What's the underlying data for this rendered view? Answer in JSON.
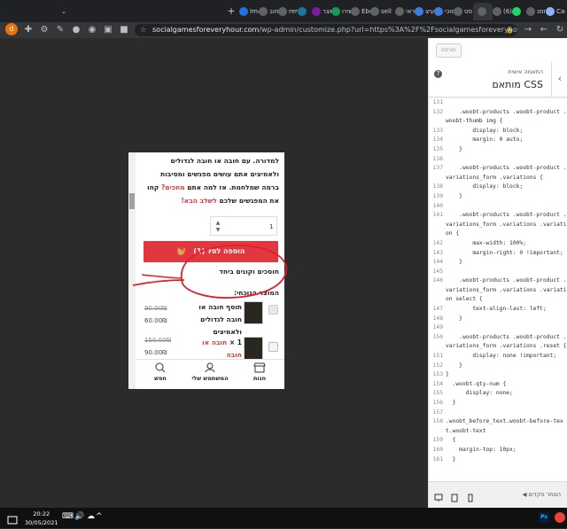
{
  "browser": {
    "tabs": [
      {
        "label": "Car",
        "icon_color": "#8ab4f8",
        "active": false
      },
      {
        "label": "הזמנ",
        "icon_color": "#5f6368",
        "active": false
      },
      {
        "label": "",
        "icon_color": "#25d366",
        "active": false
      },
      {
        "label": "(6)",
        "icon_color": "#5f6368",
        "active": false
      },
      {
        "label": "",
        "icon_color": "#5f6368",
        "active": true
      },
      {
        "label": "סט",
        "icon_color": "#5f6368",
        "active": false
      },
      {
        "label": "פוכי",
        "icon_color": "#3b7ddd",
        "active": false
      },
      {
        "label": "עיצ",
        "icon_color": "#3b7ddd",
        "active": false
      },
      {
        "label": "הוראי",
        "icon_color": "#5f6368",
        "active": false
      },
      {
        "label": "sell",
        "icon_color": "#5f6368",
        "active": false
      },
      {
        "label": "Ebo",
        "icon_color": "#5f6368",
        "active": false
      },
      {
        "label": "שירו",
        "icon_color": "#0f9d58",
        "active": false
      },
      {
        "label": "מצר",
        "icon_color": "#7b1fa2",
        "active": false
      },
      {
        "label": "",
        "icon_color": "#21759b",
        "active": false
      },
      {
        "label": "rem",
        "icon_color": "#5f6368",
        "active": false
      },
      {
        "label": "חוב",
        "icon_color": "#5f6368",
        "active": false
      },
      {
        "label": "Ima",
        "icon_color": "#1a73e8",
        "active": false
      }
    ],
    "new_tab_label": "+",
    "url_domain": "socialgamesforeveryhour.com",
    "url_path": "/wp-admin/customize.php?url=https%3A%2F%2Fsocialgamesforeveryhour.com%2F..."
  },
  "preview": {
    "paragraph": "למדורה. עם חובה או חובה לגדולים ולאמיצים אתם עושים מפגשים ומסיבות ברמה שמלחמת. אז למה אתם",
    "paragraph_red": "מחכים?",
    "paragraph_tail": "קחו את המפגשים שלכם",
    "paragraph_link": "לשלב הבא!",
    "quantity": "1",
    "add_to_cart": "הוספה לסל (1)",
    "bought_together": "חוסכים וקונים ביחד",
    "current_product_label": "המוצר הנוכחי:",
    "items": [
      {
        "name": "תוסף חובה או חובה לגדולים ולאמיצים",
        "old_price": "90.00₪",
        "new_price": "60.00₪"
      },
      {
        "qty_prefix": "1 ×",
        "name_red": "חובה או חובה",
        "old_price": "150.00₪",
        "new_price": "90.00₪"
      }
    ],
    "bottom_nav": [
      {
        "label": "חנות",
        "icon": "shop-icon"
      },
      {
        "label": "המשתמש שלי",
        "icon": "user-icon"
      },
      {
        "label": "חפש",
        "icon": "search-icon"
      }
    ]
  },
  "customizer": {
    "publish_label": "פורסם",
    "breadcrumb": "התאמה אישית",
    "section_title": "CSS מותאם",
    "collapse_label": "הסתר פקדים",
    "code_lines": [
      {
        "n": "131",
        "t": ""
      },
      {
        "n": "132",
        "t": "    .woobt-products .woobt-product .woobt-thumb img {"
      },
      {
        "n": "133",
        "t": "        display: block;"
      },
      {
        "n": "134",
        "t": "        margin: 0 auto;"
      },
      {
        "n": "135",
        "t": "    }"
      },
      {
        "n": "136",
        "t": ""
      },
      {
        "n": "137",
        "t": "    .woobt-products .woobt-product .variations_form .variations {"
      },
      {
        "n": "138",
        "t": "        display: block;"
      },
      {
        "n": "139",
        "t": "    }"
      },
      {
        "n": "140",
        "t": ""
      },
      {
        "n": "141",
        "t": "    .woobt-products .woobt-product .variations_form .variations .variation {"
      },
      {
        "n": "142",
        "t": "        max-width: 100%;"
      },
      {
        "n": "143",
        "t": "        margin-right: 0 !important;"
      },
      {
        "n": "144",
        "t": "    }"
      },
      {
        "n": "145",
        "t": ""
      },
      {
        "n": "146",
        "t": "    .woobt-products .woobt-product .variations_form .variations .variation select {"
      },
      {
        "n": "147",
        "t": "        text-align-last: left;"
      },
      {
        "n": "148",
        "t": "    }"
      },
      {
        "n": "149",
        "t": ""
      },
      {
        "n": "150",
        "t": "    .woobt-products .woobt-product .variations_form .variations .reset {"
      },
      {
        "n": "151",
        "t": "        display: none !important;"
      },
      {
        "n": "152",
        "t": "    }"
      },
      {
        "n": "153",
        "t": "}"
      },
      {
        "n": "154",
        "t": "  .woobt-qty-num {"
      },
      {
        "n": "155",
        "t": "      display: none;"
      },
      {
        "n": "156",
        "t": "  }"
      },
      {
        "n": "157",
        "t": ""
      },
      {
        "n": "158",
        "t": ".woobt_before_text.woobt-before-text.woobt-text"
      },
      {
        "n": "159",
        "t": "  {"
      },
      {
        "n": "160",
        "t": "    margin-top: 10px;"
      },
      {
        "n": "161",
        "t": "  }"
      }
    ]
  },
  "taskbar": {
    "time": "20:22",
    "date": "30/05/2021"
  },
  "colors": {
    "accent_red": "#e0383e",
    "wp_blue": "#2271b1",
    "annotation_red": "#e0202a"
  }
}
